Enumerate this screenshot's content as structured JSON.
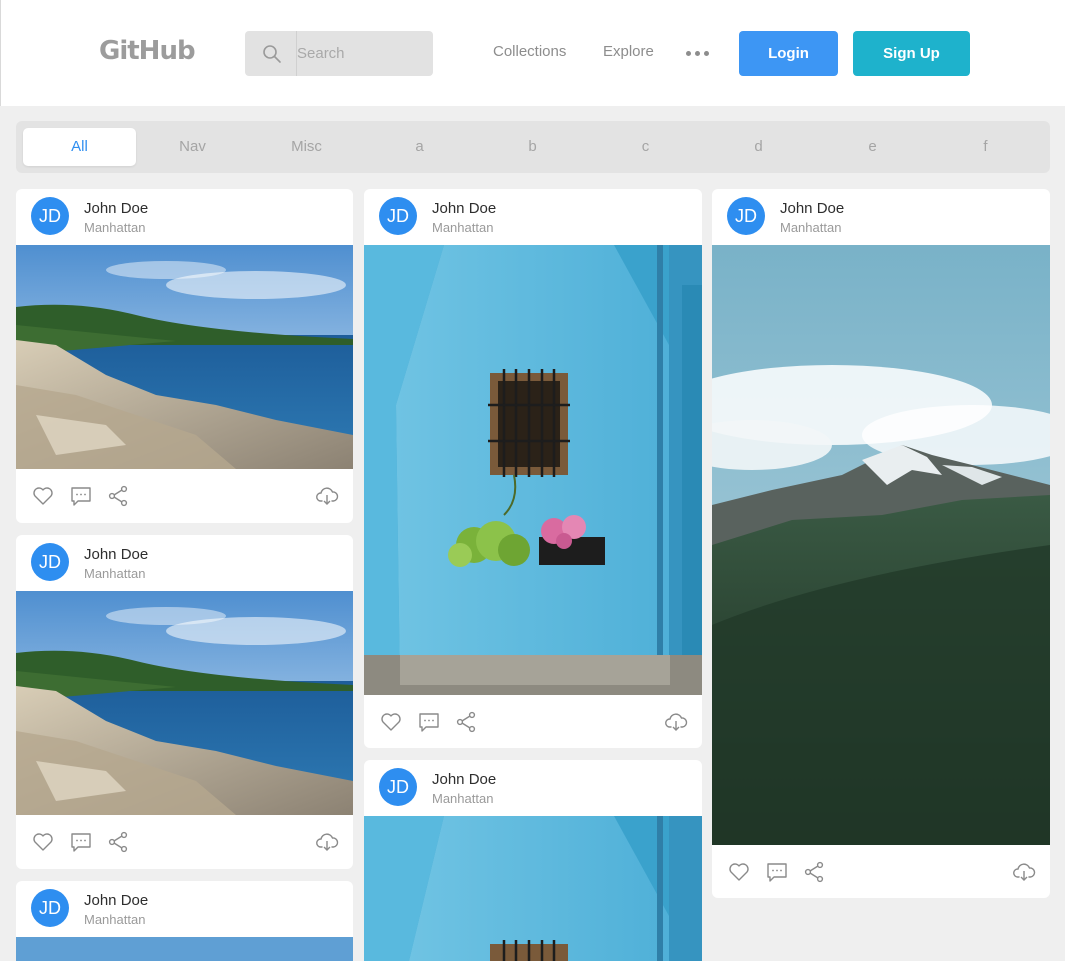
{
  "header": {
    "logo": "GitHub",
    "search_placeholder": "Search",
    "nav": [
      "Collections",
      "Explore"
    ],
    "login_label": "Login",
    "signup_label": "Sign Up"
  },
  "tabs": [
    {
      "label": "All",
      "active": true
    },
    {
      "label": "Nav",
      "active": false
    },
    {
      "label": "Misc",
      "active": false
    },
    {
      "label": "a",
      "active": false
    },
    {
      "label": "b",
      "active": false
    },
    {
      "label": "c",
      "active": false
    },
    {
      "label": "d",
      "active": false
    },
    {
      "label": "e",
      "active": false
    },
    {
      "label": "f",
      "active": false
    }
  ],
  "posts": [
    {
      "initials": "JD",
      "name": "John Doe",
      "location": "Manhattan",
      "photo": "coast"
    },
    {
      "initials": "JD",
      "name": "John Doe",
      "location": "Manhattan",
      "photo": "coast"
    },
    {
      "initials": "JD",
      "name": "John Doe",
      "location": "Manhattan",
      "photo": "coast"
    },
    {
      "initials": "JD",
      "name": "John Doe",
      "location": "Manhattan",
      "photo": "blue-wall"
    },
    {
      "initials": "JD",
      "name": "John Doe",
      "location": "Manhattan",
      "photo": "blue-wall"
    },
    {
      "initials": "JD",
      "name": "John Doe",
      "location": "Manhattan",
      "photo": "mountain"
    }
  ],
  "icons": {
    "like": "heart-icon",
    "comment": "comment-icon",
    "share": "share-icon",
    "download": "download-icon",
    "search": "search-icon",
    "more": "more-icon"
  },
  "colors": {
    "primary": "#2e8ef0",
    "login": "#3d96f4",
    "signup": "#1eb2cc",
    "header_bg": "#ffffff",
    "page_bg": "#efefef"
  }
}
